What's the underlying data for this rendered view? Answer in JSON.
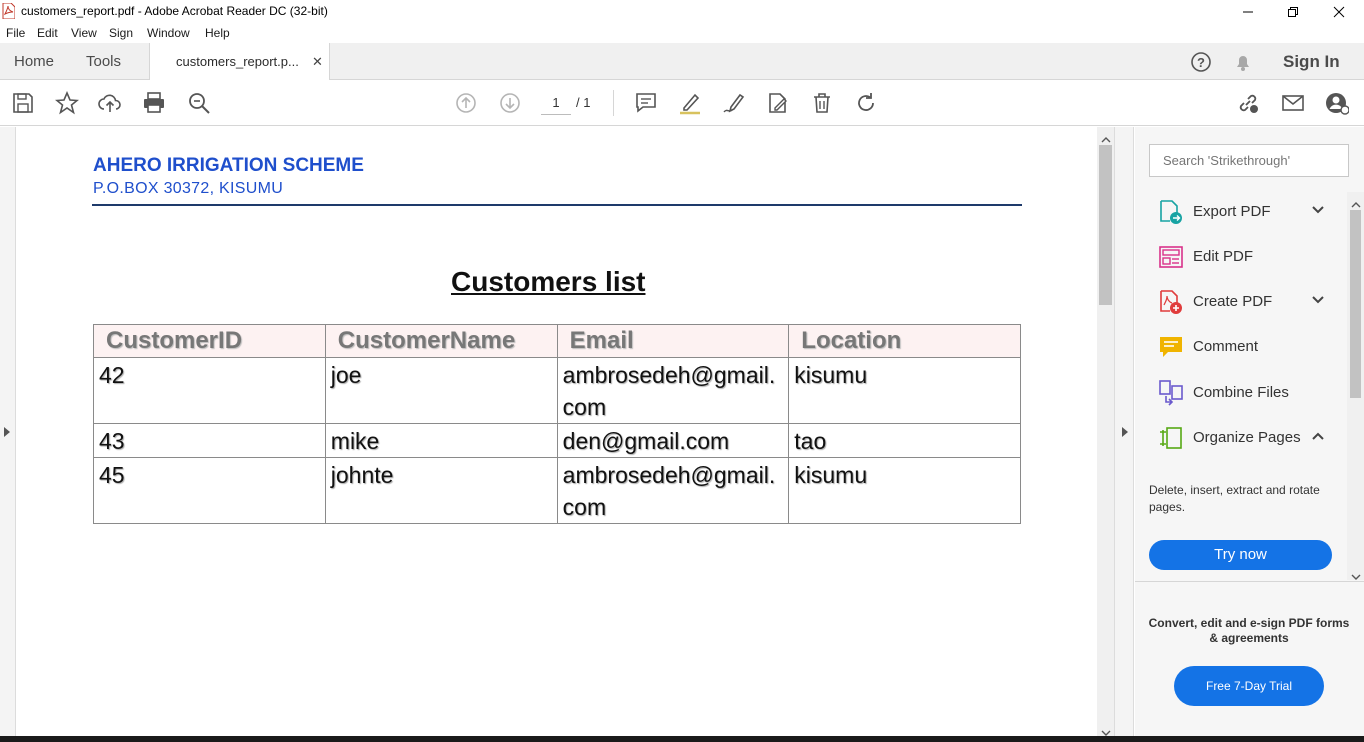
{
  "window": {
    "title": "customers_report.pdf - Adobe Acrobat Reader DC (32-bit)"
  },
  "menu": [
    "File",
    "Edit",
    "View",
    "Sign",
    "Window",
    "Help"
  ],
  "tabs": {
    "home": "Home",
    "tools": "Tools",
    "document": "customers_report.p...",
    "close_glyph": "✕"
  },
  "header_right": {
    "sign_in": "Sign In"
  },
  "toolbar": {
    "page_current": "1",
    "page_total": "/ 1"
  },
  "document": {
    "company": "AHERO IRRIGATION SCHEME",
    "address": "P.O.BOX  30372, KISUMU",
    "title": "Customers list",
    "table": {
      "headers": [
        "CustomerID",
        "CustomerName",
        "Email",
        "Location"
      ],
      "rows": [
        [
          "42",
          "joe",
          "ambrosedeh@gmail.com",
          "kisumu"
        ],
        [
          "43",
          "mike",
          "den@gmail.com",
          "tao"
        ],
        [
          "45",
          "johnte",
          "ambrosedeh@gmail.com",
          "kisumu"
        ]
      ]
    }
  },
  "right_panel": {
    "search_placeholder": "Search 'Strikethrough'",
    "tools": [
      {
        "label": "Export PDF",
        "icon": "export-pdf-icon",
        "color": "#17a3a3"
      },
      {
        "label": "Edit PDF",
        "icon": "edit-pdf-icon",
        "color": "#d9328a"
      },
      {
        "label": "Create PDF",
        "icon": "create-pdf-icon",
        "color": "#e03c3c"
      },
      {
        "label": "Comment",
        "icon": "comment-icon",
        "color": "#f0b400"
      },
      {
        "label": "Combine Files",
        "icon": "combine-files-icon",
        "color": "#6a5acd"
      },
      {
        "label": "Organize Pages",
        "icon": "organize-pages-icon",
        "color": "#57a814"
      }
    ],
    "promo_text": "Delete, insert, extract and rotate pages.",
    "try_now": "Try now",
    "convert_text": "Convert, edit and e-sign PDF forms & agreements",
    "trial_button": "Free 7-Day Trial"
  },
  "colors": {
    "accent_blue": "#1473e6",
    "company_blue": "#1f4fcc"
  }
}
